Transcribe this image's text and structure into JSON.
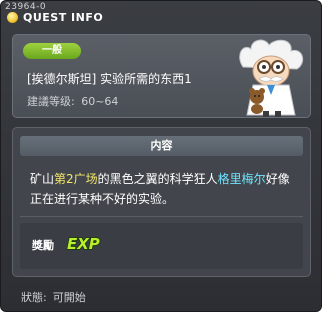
{
  "window": {
    "quest_id": "23964-0",
    "title": "QUEST INFO"
  },
  "header": {
    "category": "一般",
    "quest_name": "[挨德尔斯坦] 实验所需的东西1",
    "level_label": "建議等级:",
    "level_range": "60~64",
    "npc_icon": "scientist-npc-icon"
  },
  "content": {
    "section_title": "内容",
    "description_parts": [
      "矿山",
      "第2广场",
      "的黑色之翼的科学狂人",
      "格里梅尔",
      "好像正在进行某种不好的实验。"
    ],
    "reward_label": "獎勵",
    "reward_exp_label": "EXP",
    "reward_icon": "exp-icon"
  },
  "footer": {
    "status_label": "狀態:",
    "status_value": "可開始"
  },
  "colors": {
    "category_badge": "#7cba2a",
    "highlight_place": "#f3e66a",
    "highlight_npc": "#6fe3ff",
    "exp_text": "#b8ef2e"
  }
}
